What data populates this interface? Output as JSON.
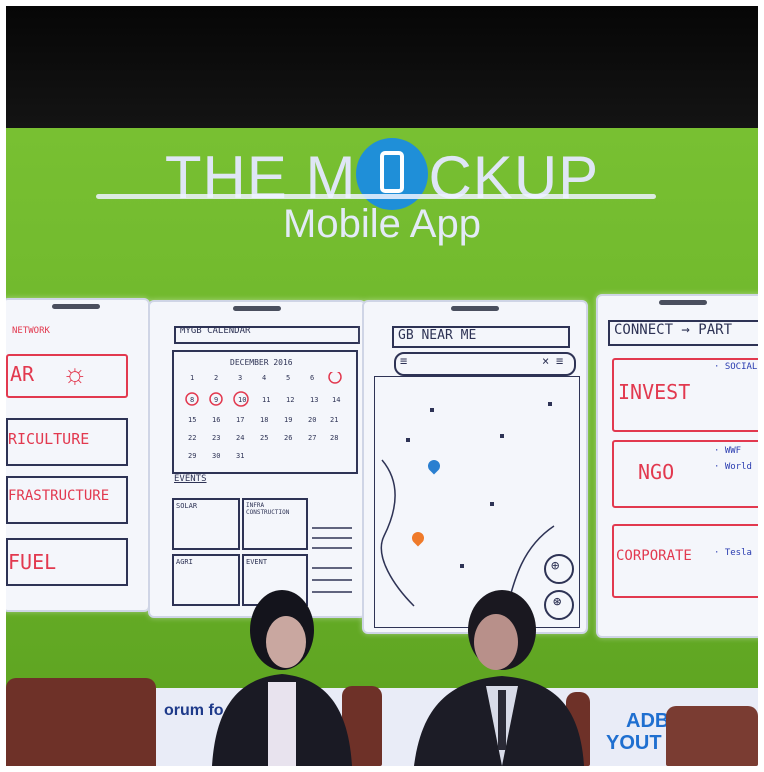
{
  "slide": {
    "title_before": "THE M",
    "title_after": "CKUP",
    "subtitle": "Mobile App"
  },
  "mockups": {
    "network": {
      "header": "NETWORK",
      "items": [
        "AR",
        "RICULTURE",
        "FRASTRUCTURE",
        "FUEL"
      ]
    },
    "calendar": {
      "header": "MYGB CALENDAR",
      "month": "DECEMBER 2016",
      "events_label": "EVENTS",
      "event_cards": [
        "SOLAR",
        "INFRA CONSTRUCTION",
        "AGRI",
        "EVENT"
      ]
    },
    "near_me": {
      "header": "GB NEAR ME"
    },
    "connect": {
      "header": "CONNECT → PART",
      "items": [
        "INVEST",
        "NGO",
        "CORPORATE"
      ],
      "side_notes": [
        "· SOCIAL",
        "· WWF",
        "· World",
        "· Tesla"
      ]
    }
  },
  "banner": {
    "left_text": "orum fo",
    "right_text_1": "ADB",
    "right_text_2": "YOUT"
  }
}
